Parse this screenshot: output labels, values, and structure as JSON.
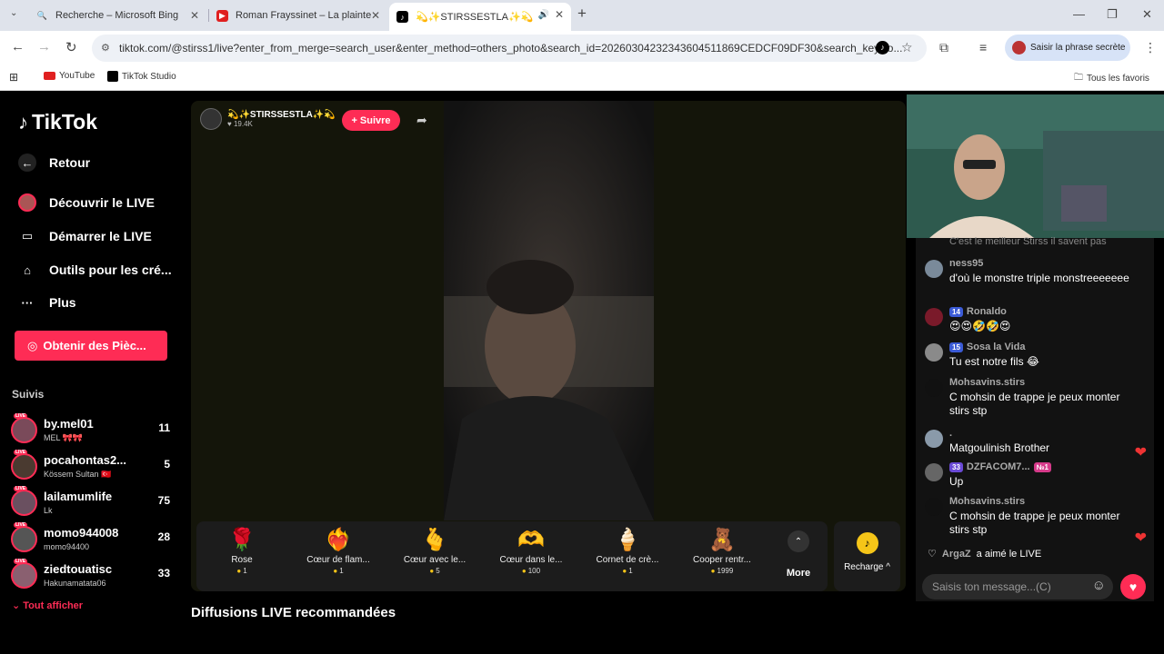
{
  "browser": {
    "tabs": [
      {
        "title": "Recherche – Microsoft Bing",
        "color": "#1a73e8",
        "icon": "search-icon"
      },
      {
        "title": "Roman Frayssinet – La plainte",
        "color": "#e02020",
        "icon": "youtube-icon"
      },
      {
        "title": "💫✨STIRSSESTLA✨💫 (",
        "color": "#000000",
        "icon": "tiktok-icon"
      }
    ],
    "url": "tiktok.com/@stirss1/live?enter_from_merge=search_user&enter_method=others_photo&search_id=20260304232343604511869CEDCF09DF30&search_keywo...",
    "secret_label": "Saisir la phrase secrète",
    "bookmarks": [
      {
        "label": "YouTube",
        "icon": "youtube-icon"
      },
      {
        "label": "TikTok Studio",
        "icon": "tiktok-icon"
      }
    ],
    "all_favorites": "Tous les favoris"
  },
  "sidebar": {
    "logo": "TikTok",
    "back": "Retour",
    "menu": [
      {
        "label": "Découvrir le LIVE",
        "icon": "live-discover-icon"
      },
      {
        "label": "Démarrer le LIVE",
        "icon": "camera-icon"
      },
      {
        "label": "Outils pour les cré...",
        "icon": "creator-tools-icon"
      },
      {
        "label": "Plus",
        "icon": "more-icon"
      }
    ],
    "coins_button": "Obtenir des Pièc...",
    "following_label": "Suivis",
    "following": [
      {
        "name": "by.mel01",
        "sub": "MEL 🎀🎀",
        "count": "11"
      },
      {
        "name": "pocahontas2...",
        "sub": "Kössem Sultan 🇹🇷",
        "count": "5"
      },
      {
        "name": "lailamumlife",
        "sub": "Lk",
        "count": "75"
      },
      {
        "name": "momo944008",
        "sub": "momo94400",
        "count": "28"
      },
      {
        "name": "ziedtouatisc",
        "sub": "Hakunamatata06",
        "count": "33"
      }
    ],
    "see_all": "Tout afficher"
  },
  "live": {
    "host_name": "💫✨STIRSSESTLA✨💫",
    "host_likes": "19.4K",
    "follow_button": "+ Suivre",
    "gifts": [
      {
        "name": "Rose",
        "price": "1",
        "emoji": "🌹"
      },
      {
        "name": "Cœur de flam...",
        "price": "1",
        "emoji": "❤️‍🔥"
      },
      {
        "name": "Cœur avec le...",
        "price": "5",
        "emoji": "🫰"
      },
      {
        "name": "Cœur dans le...",
        "price": "100",
        "emoji": "🫶"
      },
      {
        "name": "Cornet de crè...",
        "price": "1",
        "emoji": "🍦"
      },
      {
        "name": "Cooper rentr...",
        "price": "1999",
        "emoji": "🧸"
      }
    ],
    "more_label": "More",
    "recharge_label": "Recharge ^",
    "recommended_title": "Diffusions LIVE recommandées"
  },
  "chat": {
    "top_partial": "C'est le meilleur Stirss il savent pas",
    "messages": [
      {
        "user": "ness95",
        "badge": "",
        "text": "d'où le monstre triple monstreeeeeee",
        "heart": false
      },
      {
        "user": "Ronaldo",
        "badge": "14",
        "text": "😍😍🤣🤣😍",
        "heart": false
      },
      {
        "user": "Sosa la Vida",
        "badge": "15",
        "text": "Tu est notre fils 😂",
        "heart": false
      },
      {
        "user": "Mohsavins.stirs",
        "badge": "",
        "text": "C mohsin de trappe je peux monter stirs stp",
        "heart": false
      },
      {
        "user": ".",
        "badge": "",
        "text": "Matgoulinish Brother",
        "heart": true
      },
      {
        "user": "DZFACOM7...",
        "badge": "33",
        "text": "Up",
        "heart": false
      },
      {
        "user": "Mohsavins.stirs",
        "badge": "",
        "text": "C mohsin de trappe je peux monter stirs stp",
        "heart": true
      }
    ],
    "liked_user": "ArgaZ",
    "liked_text": "a aimé le LIVE",
    "input_placeholder": "Saisis ton message...(C)"
  }
}
